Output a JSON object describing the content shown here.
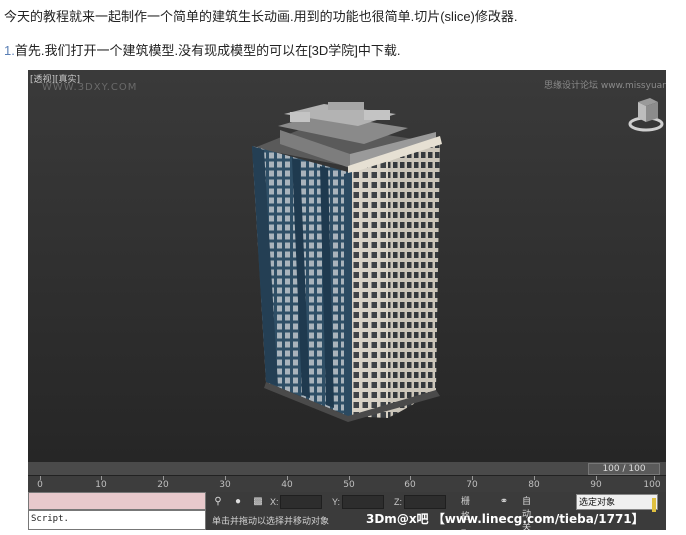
{
  "article": {
    "intro": "今天的教程就来一起制作一个简单的建筑生长动画.用到的功能也很简单.切片(slice)修改器.",
    "step_num": "1.",
    "step_text": "首先.我们打开一个建筑模型.没有现成模型的可以在[3D学院]中下载."
  },
  "viewport": {
    "label": "[透视][真实]",
    "watermark_left": "WWW.3DXY.COM",
    "watermark_right": "思缘设计论坛  www.missyuan.com"
  },
  "timeline": {
    "frame_display": "100 / 100",
    "ticks": [
      "0",
      "10",
      "20",
      "30",
      "40",
      "50",
      "60",
      "70",
      "80",
      "90",
      "100"
    ]
  },
  "statusbar": {
    "maxscript_text": "Script.",
    "x_label": "X:",
    "y_label": "Y:",
    "z_label": "Z:",
    "grid_label": "栅格 =",
    "auto_key": "自动关键点",
    "selection_value": "选定对象",
    "prompt": "单击并拖动以选择并移动对象",
    "tieba_watermark": "3Dm@x吧 【www.linecg.com/tieba/1771】"
  },
  "colors": {
    "viewport_bg": "#333333",
    "tower_blue": "#2f4f66",
    "tower_cream": "#d8d2c6",
    "maxscript_pink": "#e8c9cc"
  }
}
